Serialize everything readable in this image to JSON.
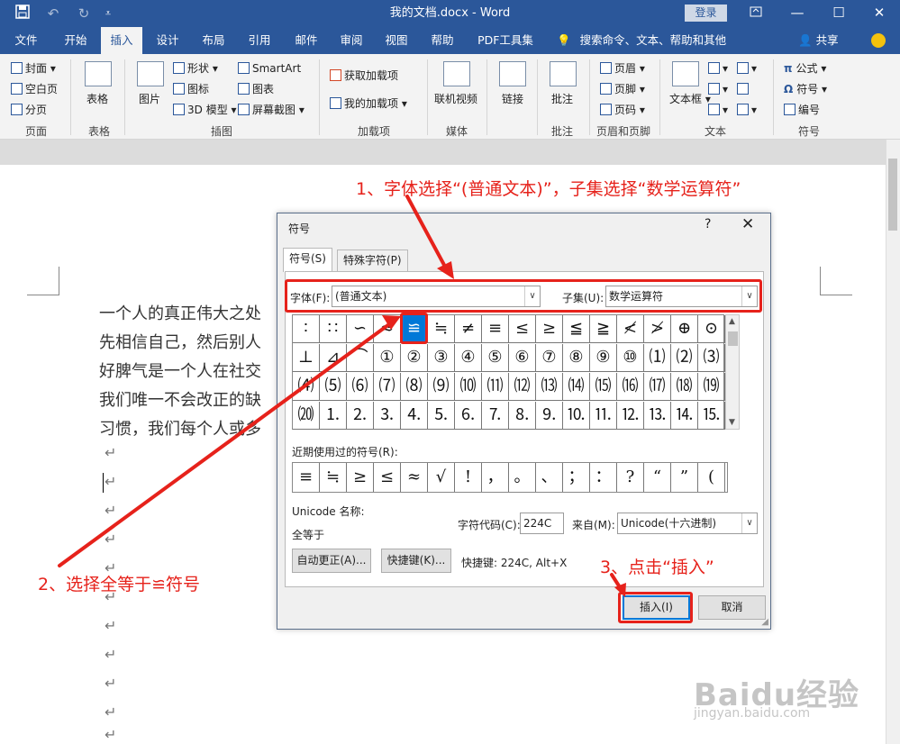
{
  "titlebar": {
    "title": "我的文档.docx - Word",
    "login": "登录",
    "quick_access": [
      "save-icon",
      "undo-icon",
      "redo-icon",
      "customize-icon"
    ]
  },
  "menubar": {
    "tabs": [
      "文件",
      "开始",
      "插入",
      "设计",
      "布局",
      "引用",
      "邮件",
      "审阅",
      "视图",
      "帮助",
      "PDF工具集"
    ],
    "active_tab": "插入",
    "tell_me": "搜索命令、文本、帮助和其他",
    "share": "共享"
  },
  "ribbon": {
    "pages": {
      "cover": "封面",
      "blank": "空白页",
      "break": "分页",
      "group": "页面"
    },
    "tables": {
      "table": "表格",
      "group": "表格"
    },
    "illustrations": {
      "picture": "图片",
      "shapes": "形状",
      "icons": "图标",
      "model3d": "3D 模型",
      "smartart": "SmartArt",
      "chart": "图表",
      "screenshot": "屏幕截图",
      "group": "插图"
    },
    "addins": {
      "get": "获取加载项",
      "mine": "我的加载项",
      "group": "加载项"
    },
    "media": {
      "video": "联机视频",
      "group": "媒体"
    },
    "links": {
      "link": "链接",
      "group": ""
    },
    "comments": {
      "comment": "批注",
      "group": "批注"
    },
    "header_footer": {
      "header": "页眉",
      "footer": "页脚",
      "page_number": "页码",
      "group": "页眉和页脚"
    },
    "text": {
      "textbox": "文本框",
      "group": "文本"
    },
    "symbols": {
      "equation": "公式",
      "symbol": "符号",
      "numbering": "编号",
      "group": "符号"
    }
  },
  "document": {
    "lines": [
      "一个人的真正伟大之处",
      "先相信自己，然后别人",
      "好脾气是一个人在社交",
      "我们唯一不会改正的缺",
      "习惯，我们每个人或多"
    ],
    "para_mark": "↵"
  },
  "dialog": {
    "title": "符号",
    "help": "?",
    "close": "✕",
    "tabs": [
      "符号(S)",
      "特殊字符(P)"
    ],
    "font_label": "字体(F):",
    "font_value": "(普通文本)",
    "subset_label": "子集(U):",
    "subset_value": "数学运算符",
    "grid": [
      [
        "∶",
        "∷",
        "∽",
        "≈",
        "≌",
        "≒",
        "≠",
        "≡",
        "≤",
        "≥",
        "≦",
        "≧",
        "≮",
        "≯",
        "⊕",
        "⊙"
      ],
      [
        "⊥",
        "⊿",
        "⌒",
        "①",
        "②",
        "③",
        "④",
        "⑤",
        "⑥",
        "⑦",
        "⑧",
        "⑨",
        "⑩",
        "⑴",
        "⑵",
        "⑶"
      ],
      [
        "⑷",
        "⑸",
        "⑹",
        "⑺",
        "⑻",
        "⑼",
        "⑽",
        "⑾",
        "⑿",
        "⒀",
        "⒁",
        "⒂",
        "⒃",
        "⒄",
        "⒅",
        "⒆"
      ],
      [
        "⒇",
        "⒈",
        "⒉",
        "⒊",
        "⒋",
        "⒌",
        "⒍",
        "⒎",
        "⒏",
        "⒐",
        "⒑",
        "⒒",
        "⒓",
        "⒔",
        "⒕",
        "⒖"
      ]
    ],
    "selected_symbol": "≌",
    "recent_label": "近期使用过的符号(R):",
    "recent": [
      "≡",
      "≒",
      "≥",
      "≤",
      "≈",
      "√",
      "!",
      "，",
      "。",
      "、",
      "；",
      "：",
      "?",
      "“",
      "”",
      "("
    ],
    "unicode_name_label": "Unicode 名称:",
    "unicode_name": "全等于",
    "char_code_label": "字符代码(C):",
    "char_code": "224C",
    "from_label": "来自(M):",
    "from_value": "Unicode(十六进制)",
    "autocorrect": "自动更正(A)...",
    "shortcut_key": "快捷键(K)...",
    "shortcut_text": "快捷键: 224C, Alt+X",
    "insert": "插入(I)",
    "cancel": "取消"
  },
  "annotations": {
    "step1": "1、字体选择“(普通文本)”，子集选择“数学运算符”",
    "step2": "2、选择全等于≌符号",
    "step3": "3、点击“插入”",
    "color": "#e6221b"
  },
  "watermark": {
    "main": "Baidu经验",
    "sub": "jingyan.baidu.com"
  },
  "colors": {
    "word_blue": "#2b579a",
    "selection_blue": "#0078d7"
  }
}
